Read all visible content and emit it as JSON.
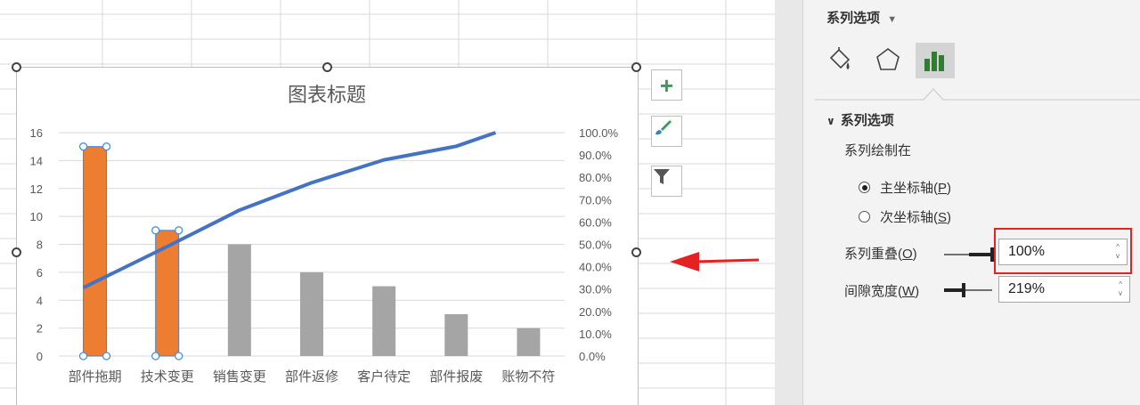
{
  "chart": {
    "title": "图表标题",
    "buttons": [
      "+",
      "brush",
      "filter"
    ]
  },
  "chart_data": {
    "type": "bar",
    "title": "图表标题",
    "categories": [
      "部件拖期",
      "技术变更",
      "销售变更",
      "部件返修",
      "客户待定",
      "部件报废",
      "账物不符"
    ],
    "series": [
      {
        "values": [
          15,
          9,
          8,
          6,
          5,
          3,
          2
        ],
        "axis": "primary",
        "highlighted": [
          0,
          1
        ]
      },
      {
        "type": "line",
        "values": [
          30.6,
          49.0,
          65.3,
          77.6,
          87.8,
          93.9,
          100.0
        ],
        "axis": "secondary",
        "unit": "%"
      }
    ],
    "ylim": [
      0,
      16
    ],
    "y_ticks": [
      "0",
      "2",
      "4",
      "6",
      "8",
      "10",
      "12",
      "14",
      "16"
    ],
    "y2lim": [
      0,
      100
    ],
    "y2_ticks": [
      "0.0%",
      "10.0%",
      "20.0%",
      "30.0%",
      "40.0%",
      "50.0%",
      "60.0%",
      "70.0%",
      "80.0%",
      "90.0%",
      "100.0%"
    ],
    "colors": {
      "highlight": "#ed7d31",
      "bar": "#a5a5a5",
      "line": "#4472c4"
    }
  },
  "panel": {
    "header": "系列选项",
    "header_arrow": "▼",
    "section": "系列选项",
    "plot_on_label": "系列绘制在",
    "primary_axis": {
      "text": "主坐标轴(",
      "key": "P",
      "end": ")"
    },
    "secondary_axis": {
      "text": "次坐标轴(",
      "key": "S",
      "end": ")"
    },
    "overlap": {
      "text": "系列重叠(",
      "key": "O",
      "end": ")",
      "value": "100%",
      "fraction": 1.0
    },
    "gap": {
      "text": "间隙宽度(",
      "key": "W",
      "end": ")",
      "value": "219%"
    }
  },
  "colors": {
    "accent_red": "#e52222",
    "chart_icon_green": "#2e7d32"
  }
}
